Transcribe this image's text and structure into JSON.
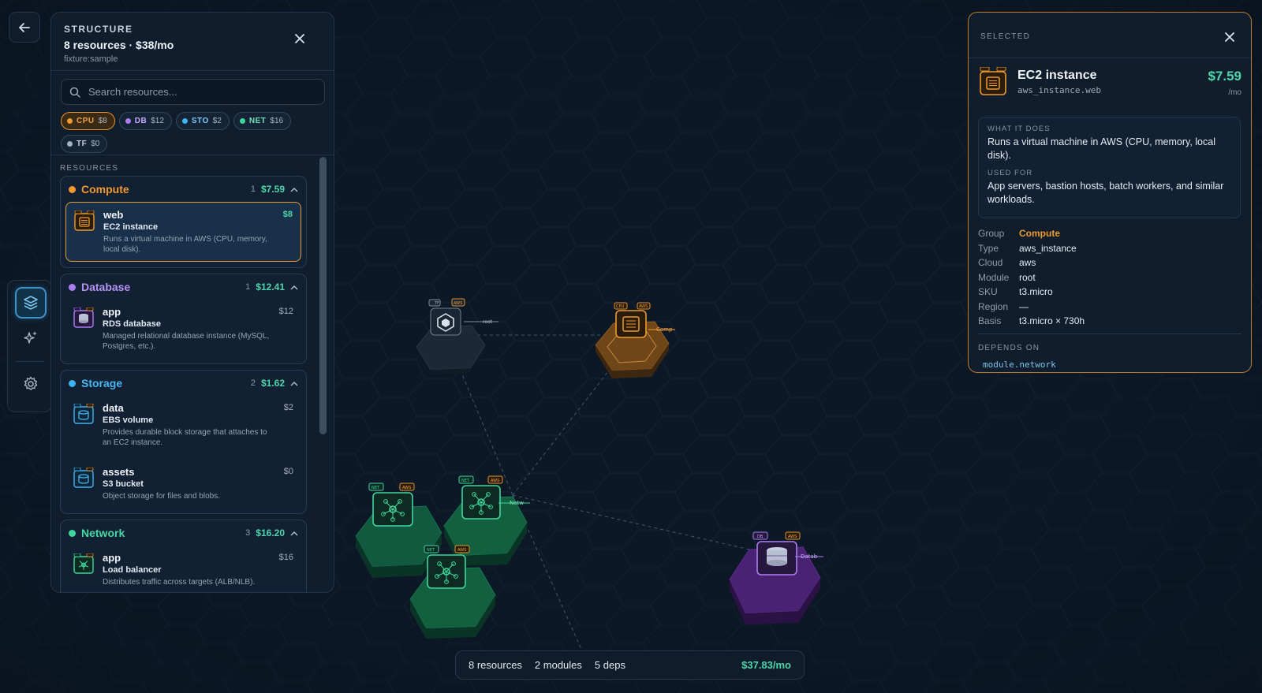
{
  "nav": {
    "back_icon": "arrow-left-icon"
  },
  "rail": {
    "items": [
      {
        "icon": "layers-icon",
        "active": true
      },
      {
        "icon": "sparkles-icon",
        "active": false
      },
      {
        "icon": "gear-icon",
        "active": false
      }
    ]
  },
  "structure": {
    "kicker": "STRUCTURE",
    "title": "8 resources · $38/mo",
    "subtitle": "fixture:sample",
    "search_placeholder": "Search resources...",
    "chips": [
      {
        "code": "CPU",
        "cost": "$8",
        "color": "#f0992e"
      },
      {
        "code": "DB",
        "cost": "$12",
        "color": "#a97ff0"
      },
      {
        "code": "STO",
        "cost": "$2",
        "color": "#3db2ef"
      },
      {
        "code": "NET",
        "cost": "$16",
        "color": "#3fd69e"
      },
      {
        "code": "TF",
        "cost": "$0",
        "color": "#a4b1bf"
      }
    ],
    "section_label": "RESOURCES",
    "groups": [
      {
        "name": "Compute",
        "count": "1",
        "cost": "$7.59",
        "color": "#f0992e",
        "resources": [
          {
            "name": "web",
            "type": "EC2 instance",
            "desc": "Runs a virtual machine in AWS (CPU, memory, local disk).",
            "cost": "$8"
          }
        ]
      },
      {
        "name": "Database",
        "count": "1",
        "cost": "$12.41",
        "color": "#a97ff0",
        "resources": [
          {
            "name": "app",
            "type": "RDS database",
            "desc": "Managed relational database instance (MySQL, Postgres, etc.).",
            "cost": "$12"
          }
        ]
      },
      {
        "name": "Storage",
        "count": "2",
        "cost": "$1.62",
        "color": "#3db2ef",
        "resources": [
          {
            "name": "data",
            "type": "EBS volume",
            "desc": "Provides durable block storage that attaches to an EC2 instance.",
            "cost": "$2"
          },
          {
            "name": "assets",
            "type": "S3 bucket",
            "desc": "Object storage for files and blobs.",
            "cost": "$0"
          }
        ]
      },
      {
        "name": "Network",
        "count": "3",
        "cost": "$16.20",
        "color": "#3fd69e",
        "resources": [
          {
            "name": "app",
            "type": "Load balancer",
            "desc": "Distributes traffic across targets (ALB/NLB).",
            "cost": "$16"
          }
        ]
      }
    ]
  },
  "selected": {
    "kicker": "SELECTED",
    "name": "EC2 instance",
    "address": "aws_instance.web",
    "cost": "$7.59",
    "per": "/mo",
    "what_label": "WHAT IT DOES",
    "what_text": "Runs a virtual machine in AWS (CPU, memory, local disk).",
    "used_label": "USED FOR",
    "used_text": "App servers, bastion hosts, batch workers, and similar workloads.",
    "props": [
      {
        "k": "Group",
        "v": "Compute"
      },
      {
        "k": "Type",
        "v": "aws_instance"
      },
      {
        "k": "Cloud",
        "v": "aws"
      },
      {
        "k": "Module",
        "v": "root"
      },
      {
        "k": "SKU",
        "v": "t3.micro"
      },
      {
        "k": "Region",
        "v": "—"
      },
      {
        "k": "Basis",
        "v": "t3.micro × 730h"
      }
    ],
    "depends_label": "DEPENDS ON",
    "depends": [
      "module.network"
    ]
  },
  "canvas": {
    "nodes": [
      {
        "kind": "tf",
        "badges": [
          "TF",
          "AWS"
        ],
        "label": "root"
      },
      {
        "kind": "cpu",
        "badges": [
          "CPU",
          "AWS"
        ],
        "label": "Comp"
      },
      {
        "kind": "net",
        "badges": [
          "NET",
          "AWS"
        ],
        "label": ""
      },
      {
        "kind": "net",
        "badges": [
          "NET",
          "AWS"
        ],
        "label": "Netw"
      },
      {
        "kind": "net",
        "badges": [
          "NET",
          "AWS"
        ],
        "label": ""
      },
      {
        "kind": "db",
        "badges": [
          "DB",
          "AWS"
        ],
        "label": "Datab"
      }
    ]
  },
  "status": {
    "resources": "8 resources",
    "modules": "2 modules",
    "deps": "5 deps",
    "total": "$37.83/mo"
  }
}
